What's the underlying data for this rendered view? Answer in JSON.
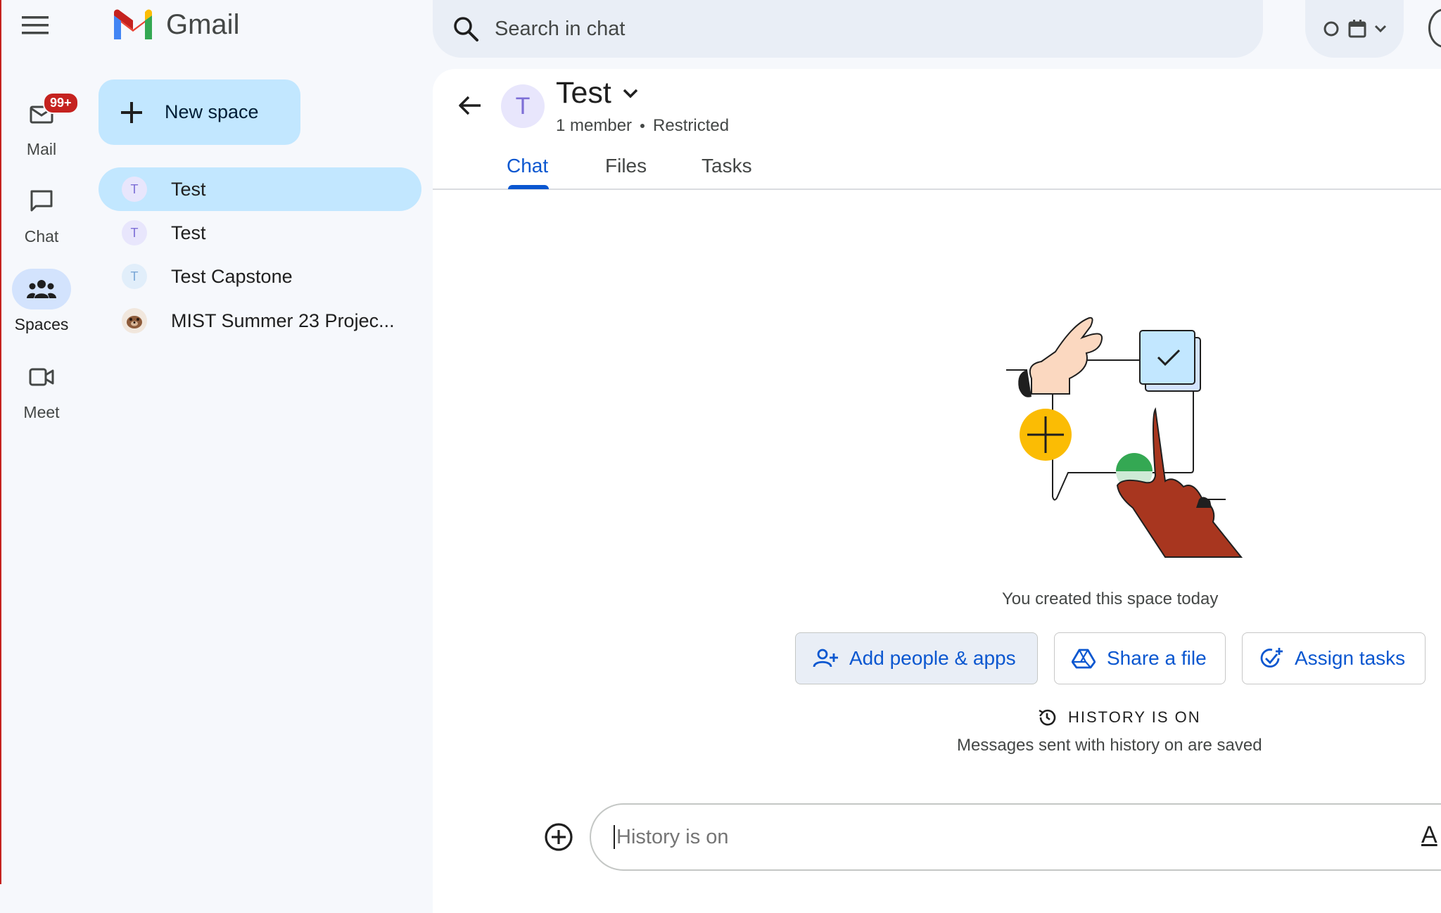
{
  "app": {
    "name": "Gmail"
  },
  "rail": {
    "items": [
      {
        "label": "Mail",
        "icon": "mail-icon",
        "badge": "99+"
      },
      {
        "label": "Chat",
        "icon": "chat-icon"
      },
      {
        "label": "Spaces",
        "icon": "spaces-icon",
        "active": true
      },
      {
        "label": "Meet",
        "icon": "video-icon"
      }
    ]
  },
  "search": {
    "placeholder": "Search in chat"
  },
  "sidebar": {
    "new_space_label": "New space",
    "spaces": [
      {
        "name": "Test",
        "initial": "T",
        "active": true
      },
      {
        "name": "Test",
        "initial": "T"
      },
      {
        "name": "Test Capstone",
        "initial": "T"
      },
      {
        "name": "MIST Summer 23 Projec...",
        "initial": ""
      }
    ]
  },
  "space": {
    "initial": "T",
    "title": "Test",
    "members": "1 member",
    "access": "Restricted",
    "tabs": [
      "Chat",
      "Files",
      "Tasks"
    ],
    "active_tab": "Chat"
  },
  "empty_state": {
    "created_text": "You created this space today",
    "actions": [
      "Add people & apps",
      "Share a file",
      "Assign tasks"
    ],
    "history_title": "HISTORY IS ON",
    "history_sub": "Messages sent with history on are saved"
  },
  "composer": {
    "placeholder": "History is on",
    "format_label": "A"
  },
  "colors": {
    "accent": "#0b57d0",
    "selected": "#c2e7ff",
    "badge": "#c5221f"
  }
}
